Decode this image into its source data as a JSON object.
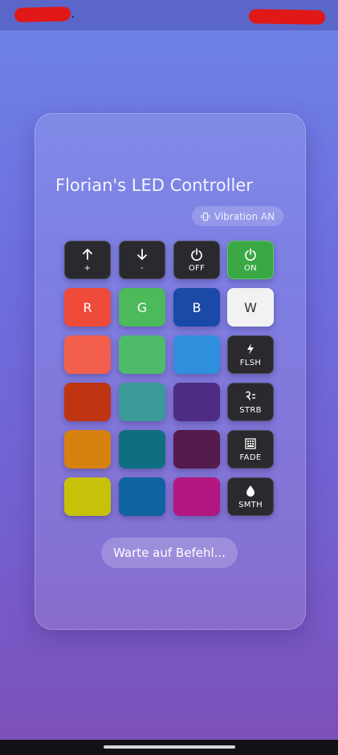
{
  "app": {
    "title": "Florian's LED Controller",
    "vibration_label": "Vibration AN",
    "status_text": "Warte auf Befehl..."
  },
  "controls": [
    {
      "name": "brightness-up-button",
      "icon": "arrow-up-icon",
      "glyph": "↑",
      "label": "+",
      "color": "#2a2a2e"
    },
    {
      "name": "brightness-down-button",
      "icon": "arrow-down-icon",
      "glyph": "↓",
      "label": "-",
      "color": "#2a2a2e"
    },
    {
      "name": "power-off-button",
      "icon": "power-icon",
      "glyph": "⏻",
      "label": "OFF",
      "color": "#2a2a2e"
    },
    {
      "name": "power-on-button",
      "icon": "power-icon",
      "glyph": "⏻",
      "label": "ON",
      "color": "#3aa845"
    }
  ],
  "primary_colors": [
    {
      "label": "R",
      "color": "#f04b3a"
    },
    {
      "label": "G",
      "color": "#4cb95a"
    },
    {
      "label": "B",
      "color": "#1b49a8"
    },
    {
      "label": "W",
      "color": "#f2f2f2"
    }
  ],
  "color_swatches": [
    [
      "#f25f4c",
      "#4dbb6a",
      "#2f8fdc"
    ],
    [
      "#bf3512",
      "#3a9b98",
      "#4e2c84"
    ],
    [
      "#d6800f",
      "#0f6f80",
      "#541b4d"
    ],
    [
      "#c8c10a",
      "#0f63a0",
      "#b2167f"
    ]
  ],
  "modes": [
    {
      "label": "FLSH",
      "icon": "flash-icon",
      "glyph": "ϟ"
    },
    {
      "label": "STRB",
      "icon": "strobe-icon",
      "glyph": "⚡"
    },
    {
      "label": "FADE",
      "icon": "fade-icon",
      "glyph": "▦"
    },
    {
      "label": "SMTH",
      "icon": "drop-icon",
      "glyph": "●"
    }
  ]
}
